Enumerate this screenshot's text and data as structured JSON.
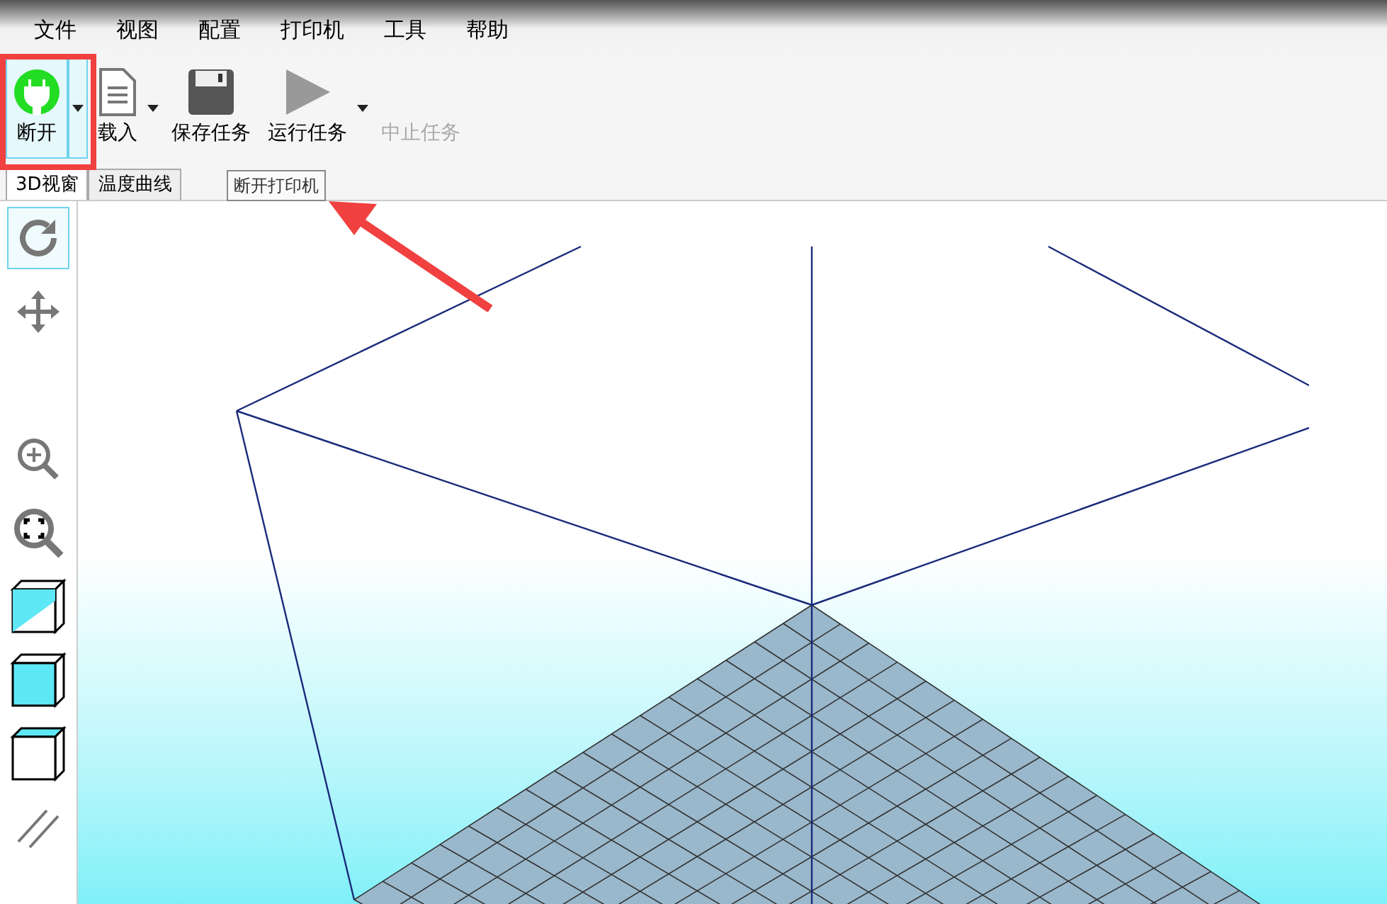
{
  "menu": [
    {
      "label": "文件"
    },
    {
      "label": "视图"
    },
    {
      "label": "配置"
    },
    {
      "label": "打印机"
    },
    {
      "label": "工具"
    },
    {
      "label": "帮助"
    }
  ],
  "toolbar": [
    {
      "kind": "connect",
      "label": "断开",
      "disabled": false,
      "dropdown": true,
      "selected": true
    },
    {
      "kind": "load",
      "label": "载入",
      "disabled": false,
      "dropdown": true,
      "selected": false
    },
    {
      "kind": "save",
      "label": "保存任务",
      "disabled": false,
      "dropdown": false,
      "selected": false
    },
    {
      "kind": "run",
      "label": "运行任务",
      "disabled": false,
      "dropdown": true,
      "selected": false
    },
    {
      "kind": "stop",
      "label": "中止任务",
      "disabled": true,
      "dropdown": false,
      "selected": false
    }
  ],
  "tabs": [
    {
      "label": "3D视窗",
      "selected": true
    },
    {
      "label": "温度曲线",
      "selected": false
    }
  ],
  "tooltip": "断开打印机",
  "view_tools": [
    {
      "kind": "rotate",
      "selected": true
    },
    {
      "kind": "move",
      "selected": false
    },
    {
      "kind": "blank",
      "selected": false
    },
    {
      "kind": "zoom-in",
      "selected": false
    },
    {
      "kind": "fit",
      "selected": false
    },
    {
      "kind": "cube-iso",
      "selected": false
    },
    {
      "kind": "cube-front",
      "selected": false
    },
    {
      "kind": "cube-top",
      "selected": false
    },
    {
      "kind": "parallel",
      "selected": false
    }
  ]
}
